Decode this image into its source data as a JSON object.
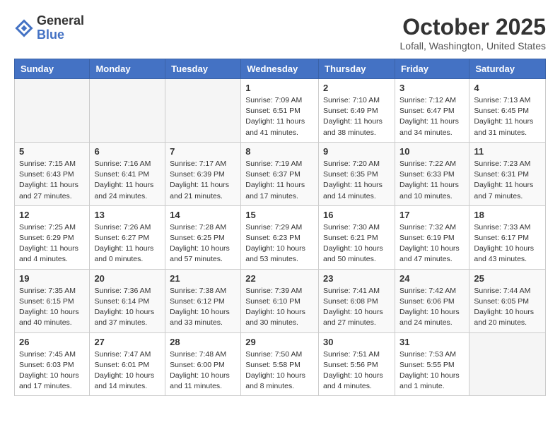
{
  "header": {
    "logo_general": "General",
    "logo_blue": "Blue",
    "month_title": "October 2025",
    "location": "Lofall, Washington, United States"
  },
  "days_of_week": [
    "Sunday",
    "Monday",
    "Tuesday",
    "Wednesday",
    "Thursday",
    "Friday",
    "Saturday"
  ],
  "weeks": [
    [
      {
        "day": "",
        "info": ""
      },
      {
        "day": "",
        "info": ""
      },
      {
        "day": "",
        "info": ""
      },
      {
        "day": "1",
        "info": "Sunrise: 7:09 AM\nSunset: 6:51 PM\nDaylight: 11 hours\nand 41 minutes."
      },
      {
        "day": "2",
        "info": "Sunrise: 7:10 AM\nSunset: 6:49 PM\nDaylight: 11 hours\nand 38 minutes."
      },
      {
        "day": "3",
        "info": "Sunrise: 7:12 AM\nSunset: 6:47 PM\nDaylight: 11 hours\nand 34 minutes."
      },
      {
        "day": "4",
        "info": "Sunrise: 7:13 AM\nSunset: 6:45 PM\nDaylight: 11 hours\nand 31 minutes."
      }
    ],
    [
      {
        "day": "5",
        "info": "Sunrise: 7:15 AM\nSunset: 6:43 PM\nDaylight: 11 hours\nand 27 minutes."
      },
      {
        "day": "6",
        "info": "Sunrise: 7:16 AM\nSunset: 6:41 PM\nDaylight: 11 hours\nand 24 minutes."
      },
      {
        "day": "7",
        "info": "Sunrise: 7:17 AM\nSunset: 6:39 PM\nDaylight: 11 hours\nand 21 minutes."
      },
      {
        "day": "8",
        "info": "Sunrise: 7:19 AM\nSunset: 6:37 PM\nDaylight: 11 hours\nand 17 minutes."
      },
      {
        "day": "9",
        "info": "Sunrise: 7:20 AM\nSunset: 6:35 PM\nDaylight: 11 hours\nand 14 minutes."
      },
      {
        "day": "10",
        "info": "Sunrise: 7:22 AM\nSunset: 6:33 PM\nDaylight: 11 hours\nand 10 minutes."
      },
      {
        "day": "11",
        "info": "Sunrise: 7:23 AM\nSunset: 6:31 PM\nDaylight: 11 hours\nand 7 minutes."
      }
    ],
    [
      {
        "day": "12",
        "info": "Sunrise: 7:25 AM\nSunset: 6:29 PM\nDaylight: 11 hours\nand 4 minutes."
      },
      {
        "day": "13",
        "info": "Sunrise: 7:26 AM\nSunset: 6:27 PM\nDaylight: 11 hours\nand 0 minutes."
      },
      {
        "day": "14",
        "info": "Sunrise: 7:28 AM\nSunset: 6:25 PM\nDaylight: 10 hours\nand 57 minutes."
      },
      {
        "day": "15",
        "info": "Sunrise: 7:29 AM\nSunset: 6:23 PM\nDaylight: 10 hours\nand 53 minutes."
      },
      {
        "day": "16",
        "info": "Sunrise: 7:30 AM\nSunset: 6:21 PM\nDaylight: 10 hours\nand 50 minutes."
      },
      {
        "day": "17",
        "info": "Sunrise: 7:32 AM\nSunset: 6:19 PM\nDaylight: 10 hours\nand 47 minutes."
      },
      {
        "day": "18",
        "info": "Sunrise: 7:33 AM\nSunset: 6:17 PM\nDaylight: 10 hours\nand 43 minutes."
      }
    ],
    [
      {
        "day": "19",
        "info": "Sunrise: 7:35 AM\nSunset: 6:15 PM\nDaylight: 10 hours\nand 40 minutes."
      },
      {
        "day": "20",
        "info": "Sunrise: 7:36 AM\nSunset: 6:14 PM\nDaylight: 10 hours\nand 37 minutes."
      },
      {
        "day": "21",
        "info": "Sunrise: 7:38 AM\nSunset: 6:12 PM\nDaylight: 10 hours\nand 33 minutes."
      },
      {
        "day": "22",
        "info": "Sunrise: 7:39 AM\nSunset: 6:10 PM\nDaylight: 10 hours\nand 30 minutes."
      },
      {
        "day": "23",
        "info": "Sunrise: 7:41 AM\nSunset: 6:08 PM\nDaylight: 10 hours\nand 27 minutes."
      },
      {
        "day": "24",
        "info": "Sunrise: 7:42 AM\nSunset: 6:06 PM\nDaylight: 10 hours\nand 24 minutes."
      },
      {
        "day": "25",
        "info": "Sunrise: 7:44 AM\nSunset: 6:05 PM\nDaylight: 10 hours\nand 20 minutes."
      }
    ],
    [
      {
        "day": "26",
        "info": "Sunrise: 7:45 AM\nSunset: 6:03 PM\nDaylight: 10 hours\nand 17 minutes."
      },
      {
        "day": "27",
        "info": "Sunrise: 7:47 AM\nSunset: 6:01 PM\nDaylight: 10 hours\nand 14 minutes."
      },
      {
        "day": "28",
        "info": "Sunrise: 7:48 AM\nSunset: 6:00 PM\nDaylight: 10 hours\nand 11 minutes."
      },
      {
        "day": "29",
        "info": "Sunrise: 7:50 AM\nSunset: 5:58 PM\nDaylight: 10 hours\nand 8 minutes."
      },
      {
        "day": "30",
        "info": "Sunrise: 7:51 AM\nSunset: 5:56 PM\nDaylight: 10 hours\nand 4 minutes."
      },
      {
        "day": "31",
        "info": "Sunrise: 7:53 AM\nSunset: 5:55 PM\nDaylight: 10 hours\nand 1 minute."
      },
      {
        "day": "",
        "info": ""
      }
    ]
  ]
}
